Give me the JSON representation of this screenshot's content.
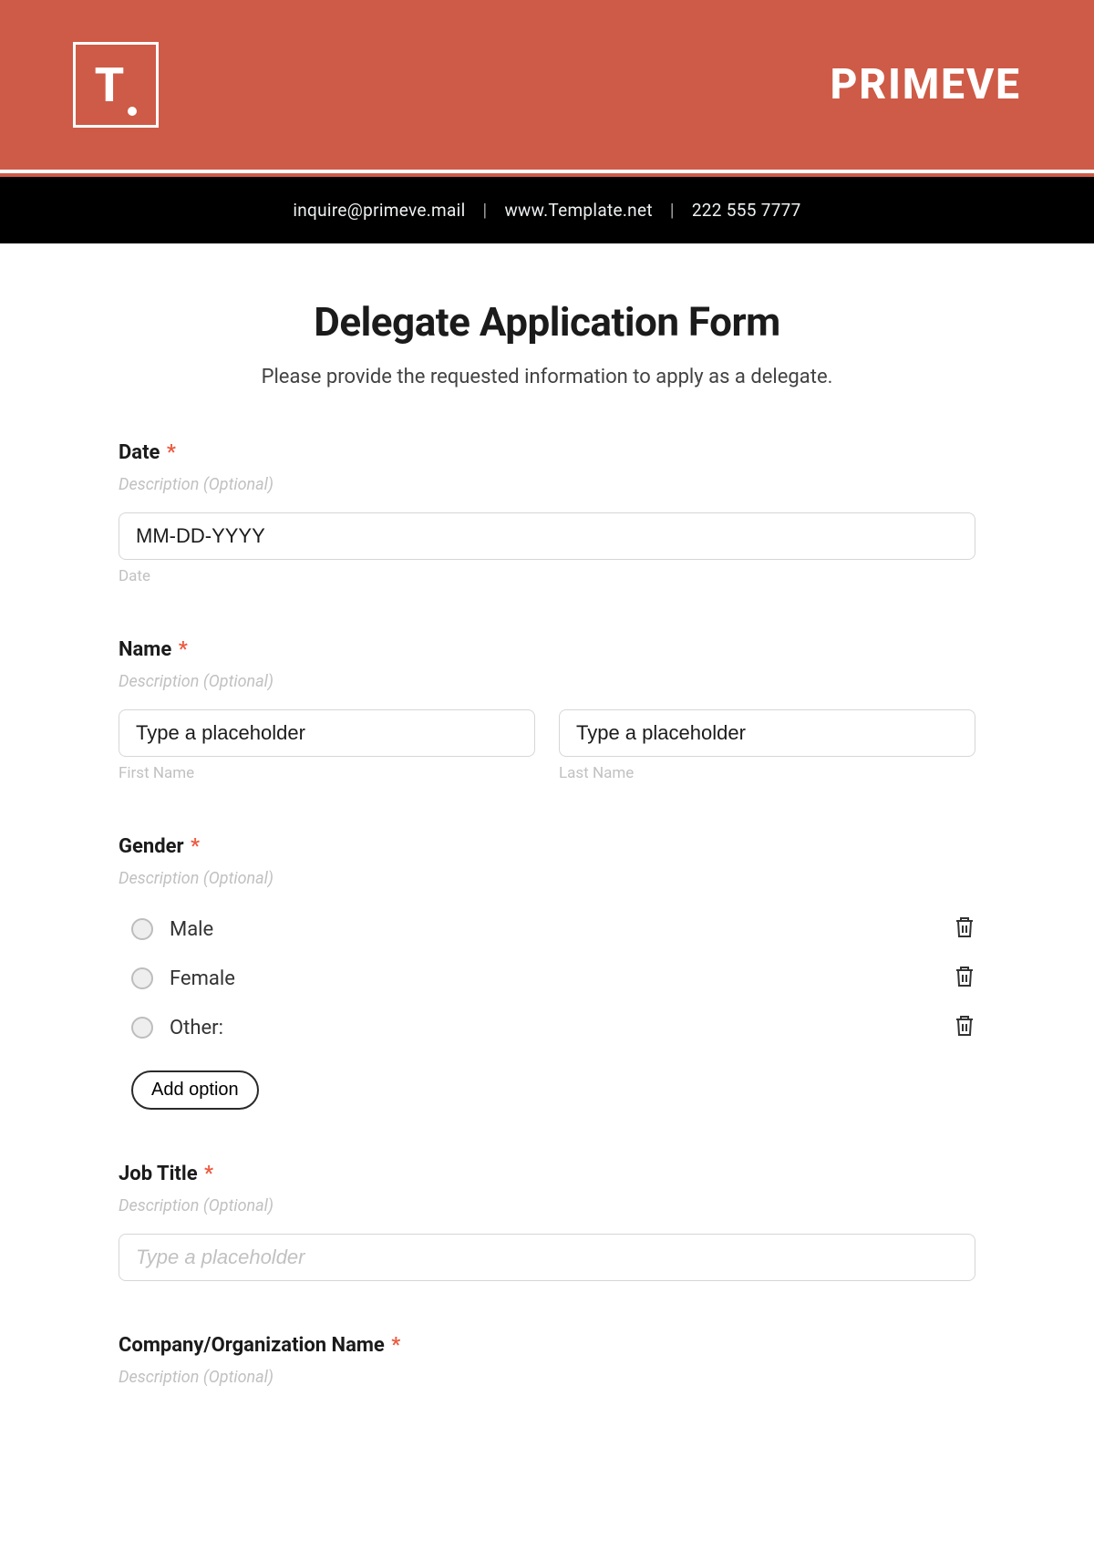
{
  "banner": {
    "logo_letter": "T",
    "brand": "PRIMEVE"
  },
  "contactbar": {
    "email": "inquire@primeve.mail",
    "site": "www.Template.net",
    "phone": "222 555 7777"
  },
  "form": {
    "title": "Delegate Application Form",
    "subtitle": "Please provide the requested information to apply as a delegate.",
    "desc_placeholder": "Description (Optional)",
    "date": {
      "label": "Date",
      "placeholder": "MM-DD-YYYY",
      "sublabel": "Date"
    },
    "name": {
      "label": "Name",
      "first_placeholder": "Type a placeholder",
      "last_placeholder": "Type a placeholder",
      "first_sub": "First Name",
      "last_sub": "Last Name"
    },
    "gender": {
      "label": "Gender",
      "options": [
        "Male",
        "Female",
        "Other:"
      ],
      "add_option": "Add option"
    },
    "jobtitle": {
      "label": "Job Title",
      "placeholder": "Type a placeholder"
    },
    "company": {
      "label": "Company/Organization Name"
    }
  }
}
